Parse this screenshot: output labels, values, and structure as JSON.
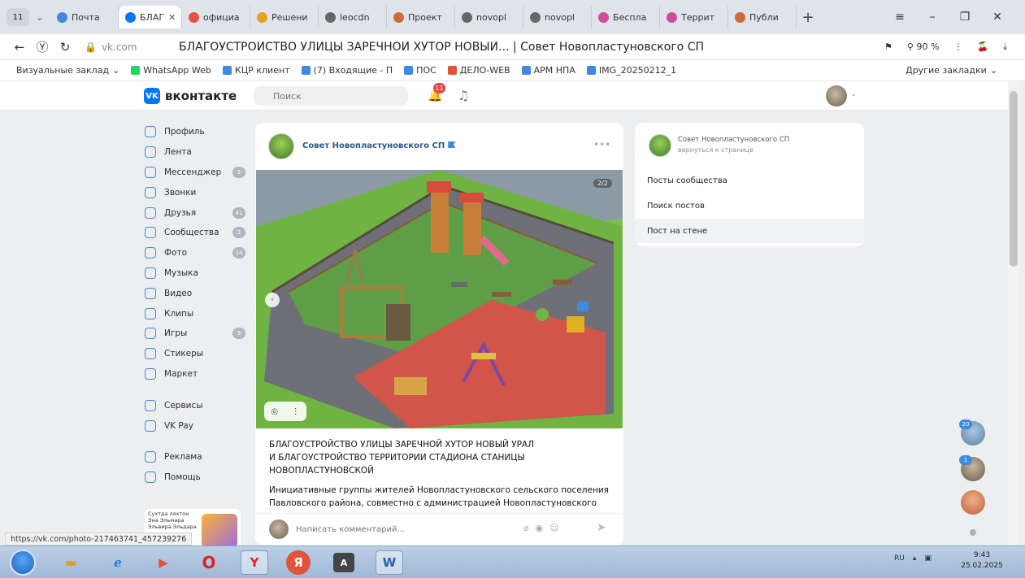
{
  "browser": {
    "tab_count": "11",
    "tabs": [
      {
        "label": "Почта",
        "color": "#3f8ae0",
        "active": false
      },
      {
        "label": "БЛАГ",
        "color": "#0077ff",
        "active": true
      },
      {
        "label": "официа",
        "color": "#e0533d",
        "active": false
      },
      {
        "label": "Решени",
        "color": "#e8a020",
        "active": false
      },
      {
        "label": "leocdn",
        "color": "#666666",
        "active": false
      },
      {
        "label": "Проект",
        "color": "#d06a3a",
        "active": false
      },
      {
        "label": "novopl",
        "color": "#666666",
        "active": false
      },
      {
        "label": "novopl",
        "color": "#666666",
        "active": false
      },
      {
        "label": "Беспла",
        "color": "#d04a9a",
        "active": false
      },
      {
        "label": "Террит",
        "color": "#d04a9a",
        "active": false
      },
      {
        "label": "Публи",
        "color": "#d06a3a",
        "active": false
      }
    ],
    "url_host": "vk.com",
    "page_title": "БЛАГОУСТРОЙСТВО УЛИЦЫ ЗАРЕЧНОЙ ХУТОР НОВЫЙ... | Совет Новопластуновского СП",
    "zoom": "90 %",
    "bookmarks": [
      {
        "label": "Визуальные заклад",
        "color": ""
      },
      {
        "label": "WhatsApp Web",
        "color": "#25d366"
      },
      {
        "label": "КЦР клиент",
        "color": "#3f8ae0"
      },
      {
        "label": "(7) Входящие - П",
        "color": "#3f8ae0"
      },
      {
        "label": "ПОС",
        "color": "#3f8ae0"
      },
      {
        "label": "ДЕЛО-WEB",
        "color": "#e0533d"
      },
      {
        "label": "АРМ НПА",
        "color": "#3f8ae0"
      },
      {
        "label": "IMG_20250212_1",
        "color": "#3f8ae0"
      }
    ],
    "other_bookmarks": "Другие закладки",
    "status_url": "https://vk.com/photo-217463741_457239276"
  },
  "vk": {
    "logo": "вконтакте",
    "search_placeholder": "Поиск",
    "notif_count": "11",
    "menu": [
      {
        "label": "Профиль",
        "icon": "user-icon",
        "count": ""
      },
      {
        "label": "Лента",
        "icon": "feed-icon",
        "count": ""
      },
      {
        "label": "Мессенджер",
        "icon": "chat-icon",
        "count": "5"
      },
      {
        "label": "Звонки",
        "icon": "phone-icon",
        "count": ""
      },
      {
        "label": "Друзья",
        "icon": "friends-icon",
        "count": "41"
      },
      {
        "label": "Сообщества",
        "icon": "community-icon",
        "count": "3"
      },
      {
        "label": "Фото",
        "icon": "photo-icon",
        "count": "14"
      },
      {
        "label": "Музыка",
        "icon": "music-icon",
        "count": ""
      },
      {
        "label": "Видео",
        "icon": "video-icon",
        "count": ""
      },
      {
        "label": "Клипы",
        "icon": "clips-icon",
        "count": ""
      },
      {
        "label": "Игры",
        "icon": "games-icon",
        "count": "9"
      },
      {
        "label": "Стикеры",
        "icon": "stickers-icon",
        "count": ""
      },
      {
        "label": "Маркет",
        "icon": "market-icon",
        "count": ""
      }
    ],
    "menu2": [
      {
        "label": "Сервисы",
        "icon": "services-icon"
      },
      {
        "label": "VK Pay",
        "icon": "vkpay-icon"
      }
    ],
    "menu3": [
      {
        "label": "Реклама",
        "icon": "ads-icon"
      },
      {
        "label": "Помощь",
        "icon": "help-icon"
      }
    ],
    "promo_text": "Сухтда ляхтон Эна Эльмара Эльвира Эльдара"
  },
  "post": {
    "author": "Совет Новопластуновского СП",
    "photo_counter": "2/2",
    "title_line1": "БЛАГОУСТРОЙСТВО УЛИЦЫ ЗАРЕЧНОЙ ХУТОР НОВЫЙ УРАЛ",
    "title_line2": "И БЛАГОУСТРОЙСТВО ТЕРРИТОРИИ СТАДИОНА СТАНИЦЫ",
    "title_line3": "НОВОПЛАСТУНОВСКОЙ",
    "body_line1": "Инициативные группы жителей Новопластуновского сельского поселения",
    "body_line2": "Павловского района, совместно с администрацией Новопластуновского",
    "comment_placeholder": "Написать комментарий..."
  },
  "right_panel": {
    "name": "Совет Новопластуновского СП",
    "back": "вернуться к странице",
    "items": [
      "Посты сообщества",
      "Поиск постов",
      "Пост на стене"
    ]
  },
  "floating": {
    "badge1": "20",
    "badge2": "1"
  },
  "taskbar": {
    "lang": "RU",
    "time": "9:43",
    "date": "25.02.2025"
  }
}
